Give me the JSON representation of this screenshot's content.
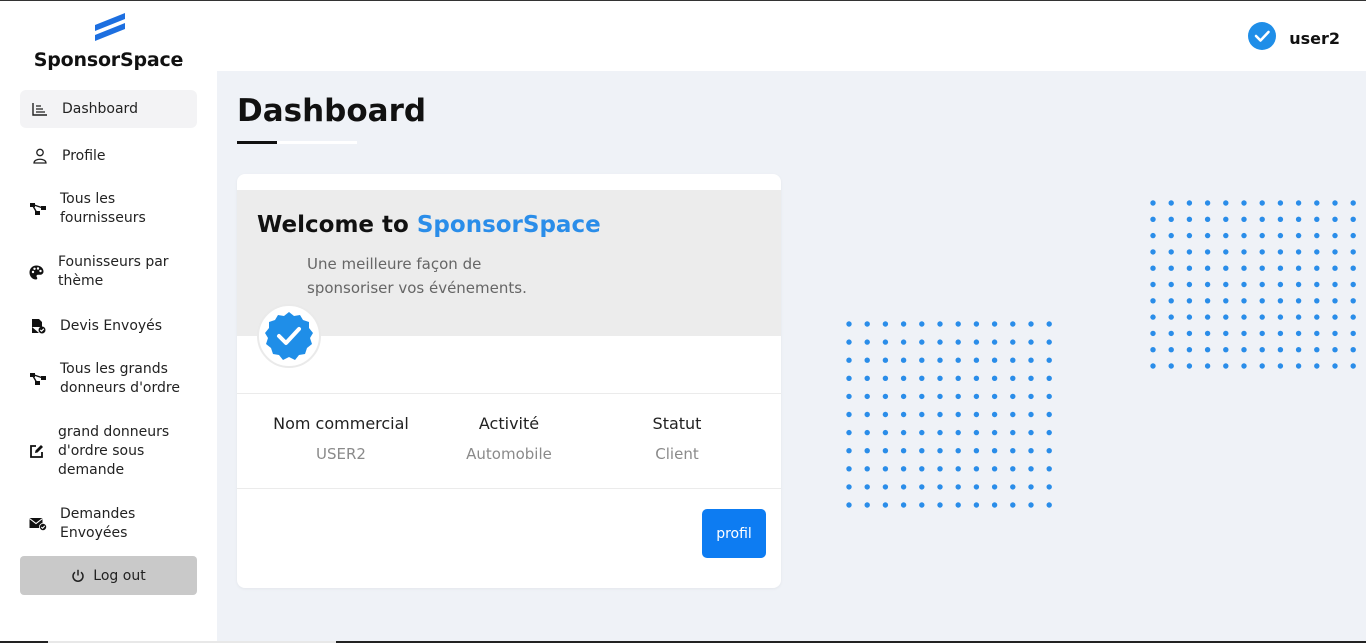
{
  "brand": {
    "name": "SponsorSpace"
  },
  "sidebar": {
    "items": [
      {
        "label": "Dashboard",
        "icon": "chart-icon",
        "active": true
      },
      {
        "label": "Profile",
        "icon": "user-icon"
      },
      {
        "label": "Tous les fournisseurs",
        "icon": "network-icon"
      },
      {
        "label": "Founisseurs par thème",
        "icon": "palette-icon"
      },
      {
        "label": "Devis Envoyés",
        "icon": "file-check-icon"
      },
      {
        "label": "Tous les grands donneurs d'ordre",
        "icon": "network-icon"
      },
      {
        "label": "grand donneurs d'ordre sous demande",
        "icon": "edit-icon"
      },
      {
        "label": "Demandes Envoyées",
        "icon": "mail-check-icon"
      }
    ],
    "logout": "Log out"
  },
  "header": {
    "user": "user2"
  },
  "page": {
    "title": "Dashboard"
  },
  "card": {
    "welcome_prefix": "Welcome to",
    "welcome_brand": "SponsorSpace",
    "tagline": "Une meilleure façon de sponsoriser vos événements.",
    "stats": [
      {
        "label": "Nom commercial",
        "value": "USER2"
      },
      {
        "label": "Activité",
        "value": "Automobile"
      },
      {
        "label": "Statut",
        "value": "Client"
      }
    ],
    "button": "profil"
  },
  "colors": {
    "accent": "#2a8de9",
    "button": "#0d7cf2",
    "background": "#eff2f7"
  }
}
